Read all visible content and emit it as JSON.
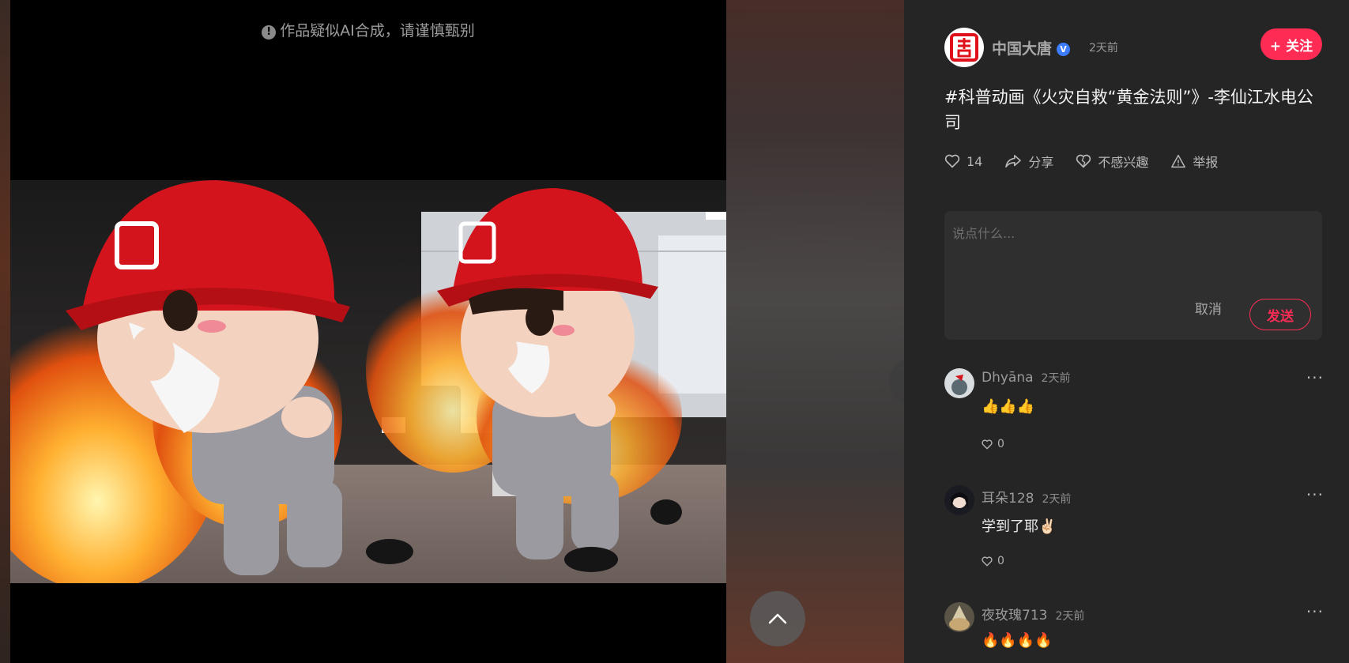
{
  "video": {
    "ai_notice": "作品疑似AI合成，请谨慎甄别",
    "ai_notice_icon": "exclamation-icon"
  },
  "author": {
    "name": "中国大唐",
    "verified": true,
    "time": "2天前",
    "follow_label": "+ 关注"
  },
  "post": {
    "title": "#科普动画《火灾自救“黄金法则”》-李仙江水电公司"
  },
  "actions": {
    "like_count": "14",
    "share_label": "分享",
    "not_interested_label": "不感兴趣",
    "report_label": "举报"
  },
  "comment_input": {
    "placeholder": "说点什么...",
    "cancel_label": "取消",
    "send_label": "发送"
  },
  "comments": [
    {
      "user": "Dhyāna",
      "time": "2天前",
      "text": "👍👍👍",
      "likes": "0"
    },
    {
      "user": "耳朵128",
      "time": "2天前",
      "text": "学到了耶✌🏻",
      "likes": "0"
    },
    {
      "user": "夜玫瑰713",
      "time": "2天前",
      "text": "🔥🔥🔥🔥",
      "likes": ""
    }
  ],
  "colors": {
    "accent": "#fe2c55",
    "panel_bg": "#252525",
    "verified": "#3c7cff"
  }
}
